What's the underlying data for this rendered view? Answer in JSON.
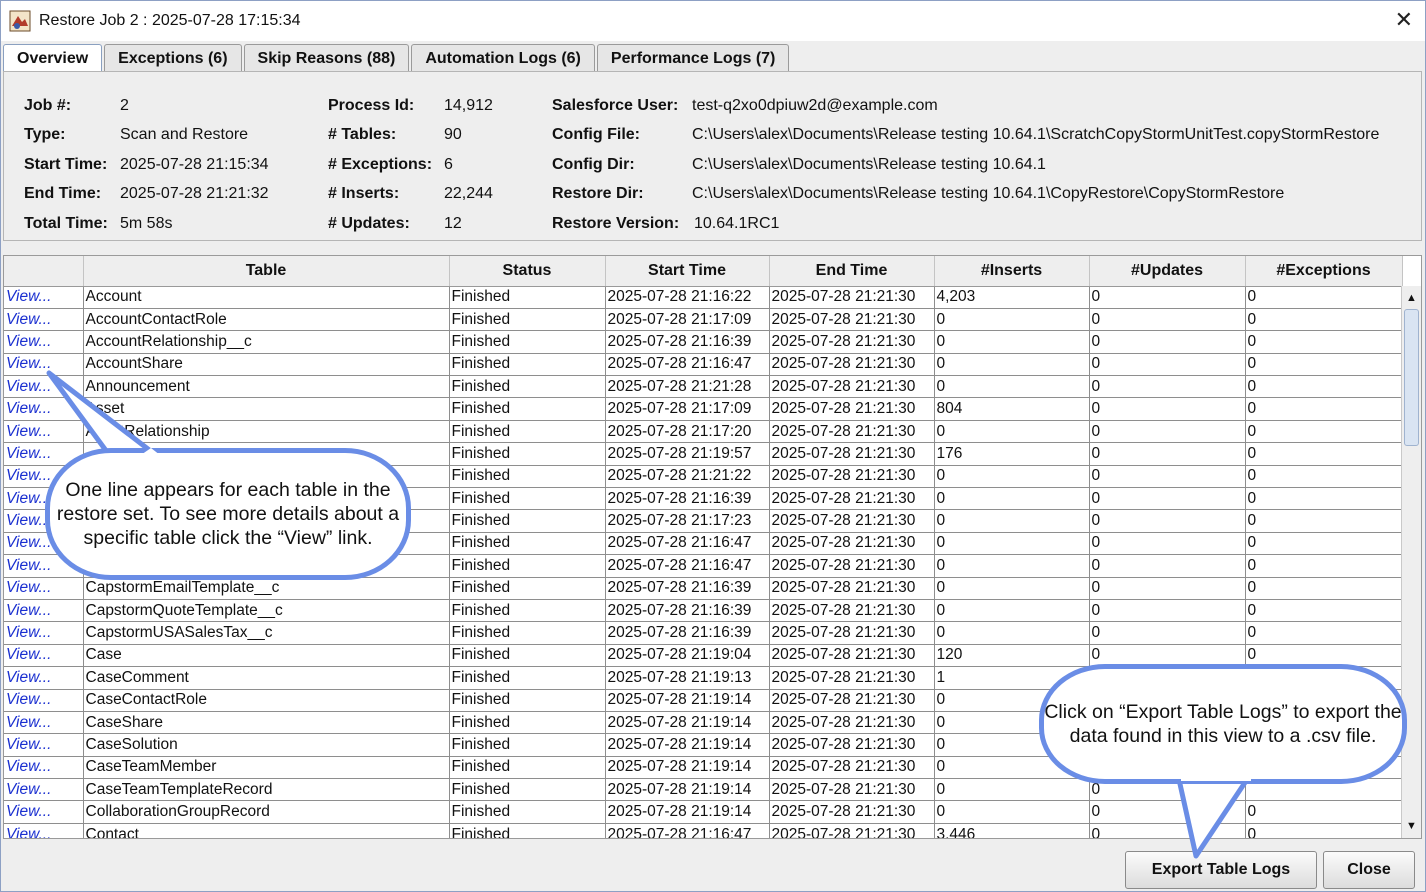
{
  "window": {
    "title": "Restore Job 2 : 2025-07-28 17:15:34",
    "close_glyph": "✕"
  },
  "tabs": [
    {
      "label": "Overview"
    },
    {
      "label": "Exceptions (6)"
    },
    {
      "label": "Skip Reasons (88)"
    },
    {
      "label": "Automation Logs (6)"
    },
    {
      "label": "Performance Logs (7)"
    }
  ],
  "overview": {
    "job_label": "Job #:",
    "job_value": "2",
    "type_label": "Type:",
    "type_value": "Scan and Restore",
    "start_label": "Start Time:",
    "start_value": "2025-07-28 21:15:34",
    "end_label": "End Time:",
    "end_value": "2025-07-28 21:21:32",
    "total_label": "Total Time:",
    "total_value": "5m 58s",
    "process_label": "Process Id:",
    "process_value": "14,912",
    "tables_label": "# Tables:",
    "tables_value": "90",
    "exceptions_label": "# Exceptions:",
    "exceptions_value": "6",
    "inserts_label": "# Inserts:",
    "inserts_value": "22,244",
    "updates_label": "# Updates:",
    "updates_value": "12",
    "sfuser_label": "Salesforce User:",
    "sfuser_value": "test-q2xo0dpiuw2d@example.com",
    "configfile_label": "Config File:",
    "configfile_value": "C:\\Users\\alex\\Documents\\Release testing 10.64.1\\ScratchCopyStormUnitTest.copyStormRestore",
    "configdir_label": "Config Dir:",
    "configdir_value": "C:\\Users\\alex\\Documents\\Release testing 10.64.1",
    "restoredir_label": "Restore Dir:",
    "restoredir_value": "C:\\Users\\alex\\Documents\\Release testing 10.64.1\\CopyRestore\\CopyStormRestore",
    "restorever_label": "Restore Version:",
    "restorever_value": "10.64.1RC1"
  },
  "table": {
    "columns": [
      "",
      "Table",
      "Status",
      "Start Time",
      "End Time",
      "#Inserts",
      "#Updates",
      "#Exceptions"
    ],
    "rows": [
      [
        "View...",
        "Account",
        "Finished",
        "2025-07-28 21:16:22",
        "2025-07-28 21:21:30",
        "4,203",
        "0",
        "0"
      ],
      [
        "View...",
        "AccountContactRole",
        "Finished",
        "2025-07-28 21:17:09",
        "2025-07-28 21:21:30",
        "0",
        "0",
        "0"
      ],
      [
        "View...",
        "AccountRelationship__c",
        "Finished",
        "2025-07-28 21:16:39",
        "2025-07-28 21:21:30",
        "0",
        "0",
        "0"
      ],
      [
        "View...",
        "AccountShare",
        "Finished",
        "2025-07-28 21:16:47",
        "2025-07-28 21:21:30",
        "0",
        "0",
        "0"
      ],
      [
        "View...",
        "Announcement",
        "Finished",
        "2025-07-28 21:21:28",
        "2025-07-28 21:21:30",
        "0",
        "0",
        "0"
      ],
      [
        "View...",
        "Asset",
        "Finished",
        "2025-07-28 21:17:09",
        "2025-07-28 21:21:30",
        "804",
        "0",
        "0"
      ],
      [
        "View...",
        "AssetRelationship",
        "Finished",
        "2025-07-28 21:17:20",
        "2025-07-28 21:21:30",
        "0",
        "0",
        "0"
      ],
      [
        "View...",
        "",
        "Finished",
        "2025-07-28 21:19:57",
        "2025-07-28 21:21:30",
        "176",
        "0",
        "0"
      ],
      [
        "View...",
        "",
        "Finished",
        "2025-07-28 21:21:22",
        "2025-07-28 21:21:30",
        "0",
        "0",
        "0"
      ],
      [
        "View...",
        "",
        "Finished",
        "2025-07-28 21:16:39",
        "2025-07-28 21:21:30",
        "0",
        "0",
        "0"
      ],
      [
        "View...",
        "",
        "Finished",
        "2025-07-28 21:17:23",
        "2025-07-28 21:21:30",
        "0",
        "0",
        "0"
      ],
      [
        "View...",
        "",
        "Finished",
        "2025-07-28 21:16:47",
        "2025-07-28 21:21:30",
        "0",
        "0",
        "0"
      ],
      [
        "View...",
        "",
        "Finished",
        "2025-07-28 21:16:47",
        "2025-07-28 21:21:30",
        "0",
        "0",
        "0"
      ],
      [
        "View...",
        "CapstormEmailTemplate__c",
        "Finished",
        "2025-07-28 21:16:39",
        "2025-07-28 21:21:30",
        "0",
        "0",
        "0"
      ],
      [
        "View...",
        "CapstormQuoteTemplate__c",
        "Finished",
        "2025-07-28 21:16:39",
        "2025-07-28 21:21:30",
        "0",
        "0",
        "0"
      ],
      [
        "View...",
        "CapstormUSASalesTax__c",
        "Finished",
        "2025-07-28 21:16:39",
        "2025-07-28 21:21:30",
        "0",
        "0",
        "0"
      ],
      [
        "View...",
        "Case",
        "Finished",
        "2025-07-28 21:19:04",
        "2025-07-28 21:21:30",
        "120",
        "0",
        "0"
      ],
      [
        "View...",
        "CaseComment",
        "Finished",
        "2025-07-28 21:19:13",
        "2025-07-28 21:21:30",
        "1",
        "",
        ""
      ],
      [
        "View...",
        "CaseContactRole",
        "Finished",
        "2025-07-28 21:19:14",
        "2025-07-28 21:21:30",
        "0",
        "",
        ""
      ],
      [
        "View...",
        "CaseShare",
        "Finished",
        "2025-07-28 21:19:14",
        "2025-07-28 21:21:30",
        "0",
        "",
        ""
      ],
      [
        "View...",
        "CaseSolution",
        "Finished",
        "2025-07-28 21:19:14",
        "2025-07-28 21:21:30",
        "0",
        "",
        ""
      ],
      [
        "View...",
        "CaseTeamMember",
        "Finished",
        "2025-07-28 21:19:14",
        "2025-07-28 21:21:30",
        "0",
        "",
        ""
      ],
      [
        "View...",
        "CaseTeamTemplateRecord",
        "Finished",
        "2025-07-28 21:19:14",
        "2025-07-28 21:21:30",
        "0",
        "0",
        ""
      ],
      [
        "View...",
        "CollaborationGroupRecord",
        "Finished",
        "2025-07-28 21:19:14",
        "2025-07-28 21:21:30",
        "0",
        "0",
        "0"
      ],
      [
        "View...",
        "Contact",
        "Finished",
        "2025-07-28 21:16:47",
        "2025-07-28 21:21:30",
        "3,446",
        "0",
        "0"
      ]
    ]
  },
  "buttons": {
    "export_label": "Export Table Logs",
    "close_label": "Close"
  },
  "callouts": {
    "view_text": "One line appears for each table in the restore set. To see more details about a specific table click the “View” link.",
    "export_text": "Click on “Export Table Logs” to export the data found in this view to a .csv file."
  },
  "colors": {
    "link": "#1a2fd0",
    "callout_border": "#6a8de6"
  },
  "icons": {
    "app": "restore-app-icon",
    "scroll_up": "▲",
    "scroll_down": "▼"
  }
}
